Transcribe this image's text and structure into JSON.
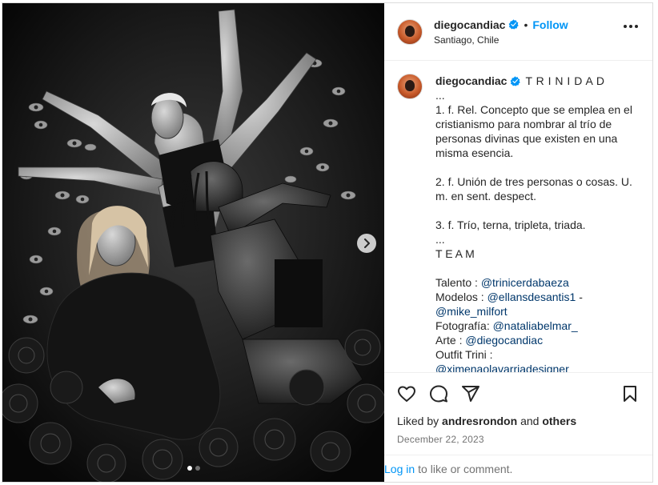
{
  "header": {
    "username": "diegocandiac",
    "separator": "•",
    "follow_label": "Follow",
    "location": "Santiago, Chile",
    "more_icon": "more-options-icon"
  },
  "caption": {
    "username": "diegocandiac",
    "title": "T R I N I D A D",
    "lines": [
      "...",
      "1. f. Rel. Concepto que se emplea en el cristianismo para nombrar al trío de personas divinas que existen en una misma esencia.",
      "",
      "2. f. Unión de tres personas o cosas. U. m. en sent. despect.",
      "",
      "3. f. Trío, terna, tripleta, triada.",
      "...",
      "T E A M",
      ""
    ],
    "credits": [
      {
        "label": "Talento : ",
        "mentions": [
          "@trinicerdabaeza"
        ]
      },
      {
        "label": "Modelos : ",
        "mentions": [
          "@ellansdesantis1",
          "@mike_milfort"
        ],
        "joiner": " - "
      },
      {
        "label": "Fotografía: ",
        "mentions": [
          "@nataliabelmar_"
        ]
      },
      {
        "label": "Arte : ",
        "mentions": [
          "@diegocandiac"
        ]
      },
      {
        "label": "Outfit Trini : ",
        "mentions": [
          "@ximenaolavarriadesigner"
        ]
      }
    ]
  },
  "actions": {
    "like_icon": "heart-icon",
    "comment_icon": "comment-icon",
    "share_icon": "share-icon",
    "save_icon": "bookmark-icon"
  },
  "likes": {
    "prefix": "Liked by",
    "user": "andresrondon",
    "joiner": "and",
    "others": "others"
  },
  "date": "December 22, 2023",
  "login": {
    "link": "Log in",
    "text": "to like or comment."
  },
  "carousel": {
    "count": 2,
    "active_index": 0
  },
  "colors": {
    "accent": "#0095f6",
    "mention": "#00376b",
    "verified": "#0095f6"
  }
}
